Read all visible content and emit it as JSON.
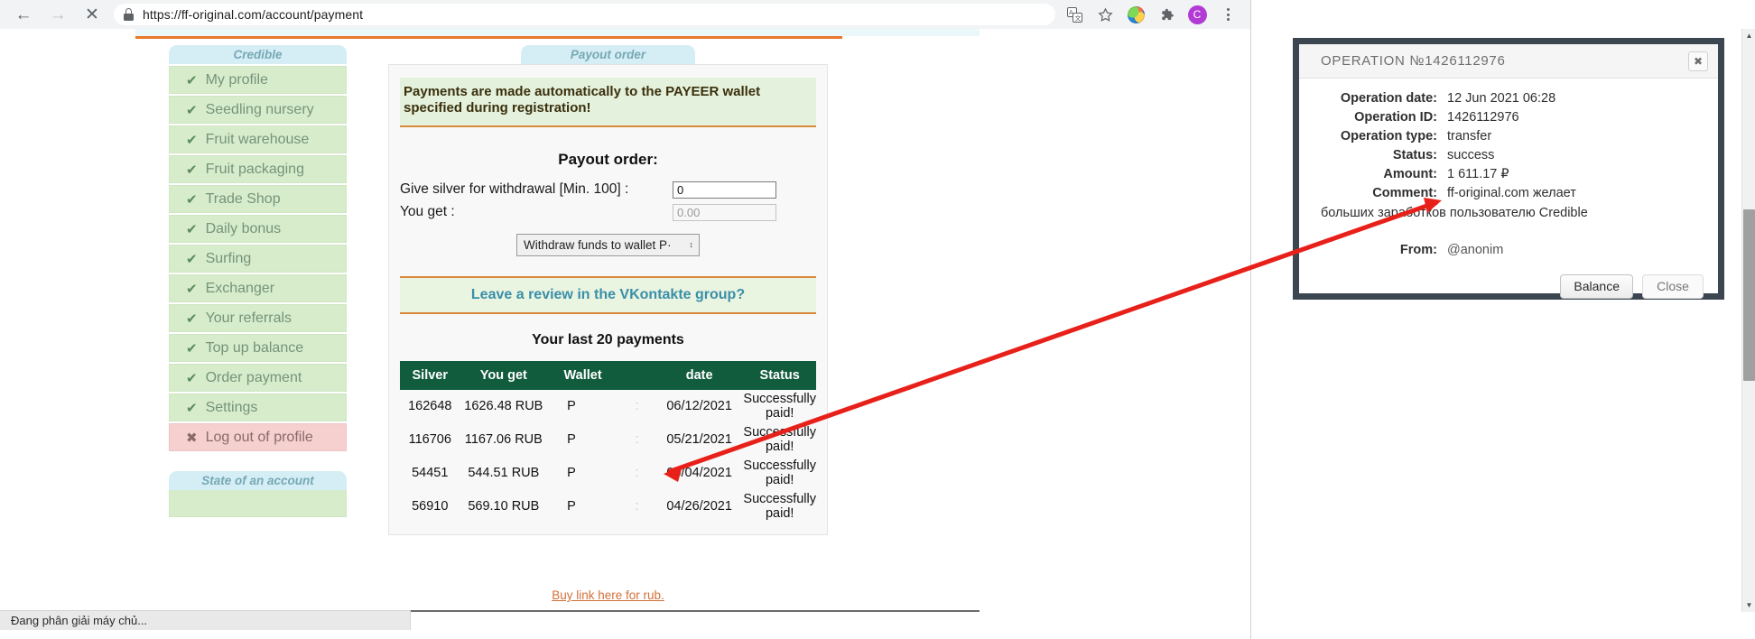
{
  "browser": {
    "back_icon": "back-arrow",
    "forward_icon": "forward-arrow",
    "stop_icon": "✕",
    "url": "https://ff-original.com/account/payment",
    "lock_icon": "lock-icon",
    "translate_icon": "translate-icon",
    "bookmark_icon": "★",
    "extension_globe_icon": "globe-extension-icon",
    "extensions_icon": "puzzle-piece-icon",
    "profile_initial": "C",
    "menu_icon": "three-dot-menu"
  },
  "sidebar": {
    "title": "Credible",
    "items": [
      {
        "label": "My profile",
        "icon": "✔"
      },
      {
        "label": "Seedling nursery",
        "icon": "✔"
      },
      {
        "label": "Fruit warehouse",
        "icon": "✔"
      },
      {
        "label": "Fruit packaging",
        "icon": "✔"
      },
      {
        "label": "Trade Shop",
        "icon": "✔"
      },
      {
        "label": "Daily bonus",
        "icon": "✔"
      },
      {
        "label": "Surfing",
        "icon": "✔"
      },
      {
        "label": "Exchanger",
        "icon": "✔"
      },
      {
        "label": "Your referrals",
        "icon": "✔"
      },
      {
        "label": "Top up balance",
        "icon": "✔"
      },
      {
        "label": "Order payment",
        "icon": "✔"
      },
      {
        "label": "Settings",
        "icon": "✔"
      }
    ],
    "logout": {
      "label": "Log out of profile",
      "icon": "✖"
    },
    "state_title": "State of an account"
  },
  "main": {
    "tab_title": "Payout order",
    "notice": "Payments are made automatically to the PAYEER wallet specified during registration!",
    "payout_heading": "Payout order:",
    "field_silver_label": "Give silver for withdrawal [Min. 100] :",
    "field_silver_value": "0",
    "field_youget_label": "You get :",
    "field_youget_value": "0.00",
    "withdraw_button": "Withdraw funds to wallet P·",
    "withdraw_button_caret": "↕",
    "review_link": "Leave a review in the VKontakte group?",
    "last_payments_title": "Your last 20 payments",
    "table": {
      "columns": [
        "Silver",
        "You get",
        "Wallet",
        "",
        "date",
        "Status"
      ],
      "rows": [
        {
          "silver": "162648",
          "you_get": "1626.48 RUB",
          "wallet": "P",
          "sep": ":",
          "date": "06/12/2021",
          "status": "Successfully paid!"
        },
        {
          "silver": "116706",
          "you_get": "1167.06 RUB",
          "wallet": "P",
          "sep": ":",
          "date": "05/21/2021",
          "status": "Successfully paid!"
        },
        {
          "silver": "54451",
          "you_get": "544.51 RUB",
          "wallet": "P",
          "sep": ":",
          "date": "05/04/2021",
          "status": "Successfully paid!"
        },
        {
          "silver": "56910",
          "you_get": "569.10 RUB",
          "wallet": "P",
          "sep": ":",
          "date": "04/26/2021",
          "status": "Successfully paid!"
        }
      ]
    },
    "buy_link": "Buy link here for rub."
  },
  "status_bar": {
    "text": "Đang phân giải máy chủ..."
  },
  "modal": {
    "title": "OPERATION №1426112976",
    "close_icon": "✖",
    "rows": [
      {
        "key": "Operation date:",
        "value": "12 Jun 2021 06:28"
      },
      {
        "key": "Operation ID:",
        "value": "1426112976"
      },
      {
        "key": "Operation type:",
        "value": "transfer"
      },
      {
        "key": "Status:",
        "value": "success"
      },
      {
        "key": "Amount:",
        "value": "1 611.17 ₽"
      },
      {
        "key": "Comment:",
        "value": "ff-original.com желает"
      }
    ],
    "comment_continued": "больших заработков пользователю Credible",
    "from_key": "From:",
    "from_value": "@anonim",
    "balance_button": "Balance",
    "close_button": "Close"
  },
  "colors": {
    "accent_orange": "#e8762c",
    "sidebar_green": "#d6eccb",
    "logout_red": "#f6cfcf",
    "table_header": "#125c3e",
    "tab_blue": "#d5eef5",
    "annotation_red": "#e8201a"
  }
}
